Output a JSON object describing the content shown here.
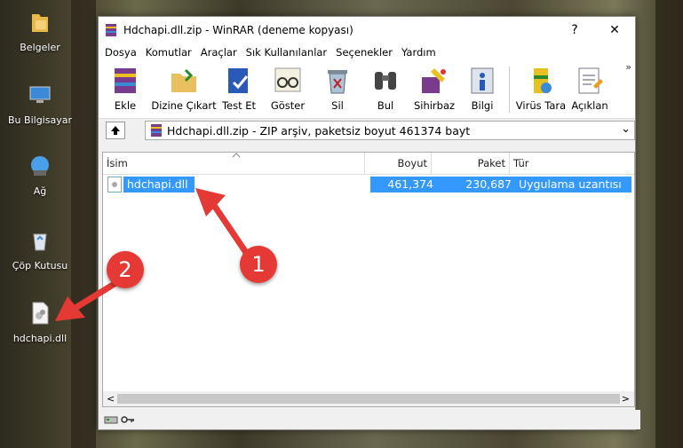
{
  "desktop": {
    "icons": [
      {
        "label": "Belgeler"
      },
      {
        "label": "Bu Bilgisayar"
      },
      {
        "label": "Ağ"
      },
      {
        "label": "Çöp Kutusu"
      },
      {
        "label": "hdchapi.dll"
      }
    ]
  },
  "window": {
    "title": "Hdchapi.dll.zip - WinRAR (deneme kopyası)",
    "help": "?",
    "close": "✕"
  },
  "menu": [
    "Dosya",
    "Komutlar",
    "Araçlar",
    "Sık Kullanılanlar",
    "Seçenekler",
    "Yardım"
  ],
  "toolbar": {
    "buttons": [
      "Ekle",
      "Dizine Çıkart",
      "Test Et",
      "Göster",
      "Sil",
      "Bul",
      "Sihirbaz",
      "Bilgi",
      "Virüs Tara",
      "Açıklan"
    ],
    "more": "»"
  },
  "address": {
    "text": "Hdchapi.dll.zip - ZIP arşiv, paketsiz boyut 461374 bayt",
    "dropdown": "⌄"
  },
  "columns": [
    "İsim",
    "Boyut",
    "Paket",
    "Tür"
  ],
  "files": [
    {
      "name": "hdchapi.dll",
      "size": "461,374",
      "packed": "230,687",
      "type": "Uygulama uzantısı"
    }
  ],
  "scroll": {
    "left": "<",
    "right": ">"
  },
  "annotations": {
    "badge1": "1",
    "badge2": "2"
  },
  "colors": {
    "selection": "#3399ff",
    "badge": "#e53935",
    "arrow": "#e53935"
  }
}
